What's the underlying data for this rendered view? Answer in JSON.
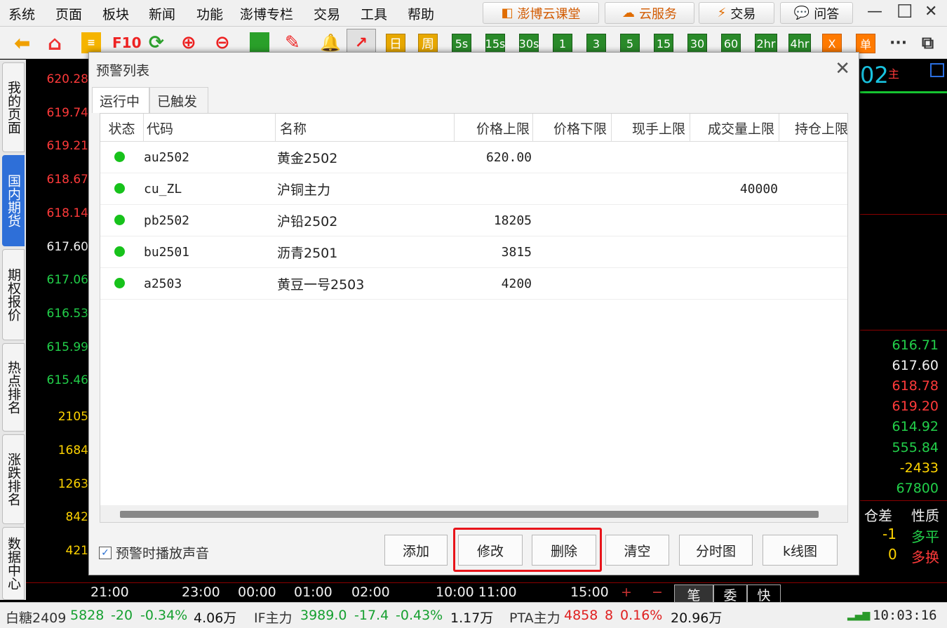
{
  "menu": [
    "系统",
    "页面",
    "板块",
    "新闻",
    "功能",
    "澎博专栏",
    "交易",
    "工具",
    "帮助"
  ],
  "header_buttons": {
    "cloud_class": "澎博云课堂",
    "cloud_service": "云服务",
    "trade": "交易",
    "qa": "问答"
  },
  "toolbar": {
    "f10": "F10",
    "periods": [
      "日",
      "周",
      "5s",
      "15s",
      "30s",
      "1",
      "3",
      "5",
      "15",
      "30",
      "60",
      "2hr",
      "4hr",
      "X",
      "单"
    ],
    "more": "···"
  },
  "sidenav": {
    "items": [
      "我的页面",
      "国内期货",
      "期权报价",
      "热点排名",
      "涨跌排名",
      "数据中心"
    ],
    "active": "国内期货",
    "expand_arrow": "▸"
  },
  "left_axis": {
    "prices": [
      {
        "v": "620.28",
        "c": "r"
      },
      {
        "v": "619.74",
        "c": "r"
      },
      {
        "v": "619.21",
        "c": "r"
      },
      {
        "v": "618.67",
        "c": "r"
      },
      {
        "v": "618.14",
        "c": "r"
      },
      {
        "v": "617.60",
        "c": "w"
      },
      {
        "v": "617.06",
        "c": "g"
      },
      {
        "v": "616.53",
        "c": "g"
      },
      {
        "v": "615.99",
        "c": "g"
      },
      {
        "v": "615.46",
        "c": "g"
      }
    ],
    "volumes": [
      "2105",
      "1684",
      "1263",
      "842",
      "421"
    ]
  },
  "right_panel": {
    "code_fragment": "02",
    "code_suffix": "主",
    "values": [
      {
        "v": "616.71",
        "c": "g"
      },
      {
        "v": "617.60",
        "c": "w"
      },
      {
        "v": "618.78",
        "c": "r"
      },
      {
        "v": "619.20",
        "c": "r"
      },
      {
        "v": "614.92",
        "c": "g"
      },
      {
        "v": "555.84",
        "c": "g"
      },
      {
        "v": "-2433",
        "c": "yl"
      },
      {
        "v": "67800",
        "c": "g"
      }
    ],
    "col_headers": [
      "仓差",
      "性质"
    ],
    "rows": [
      {
        "diff": "-1",
        "nature": "多平"
      },
      {
        "diff": "0",
        "nature": "多换"
      }
    ]
  },
  "time_axis": {
    "labels": [
      "21:00",
      "23:00",
      "00:00",
      "01:00",
      "02:00",
      "10:00 11:00",
      "15:00"
    ],
    "tabs": [
      "笔",
      "委",
      "快"
    ],
    "plus": "+",
    "minus": "−"
  },
  "status_bar": {
    "sugar": {
      "name": "白糖2409",
      "price": "5828",
      "chg": "-20",
      "pct": "-0.34%",
      "vol": "4.06万"
    },
    "if": {
      "name": "IF主力",
      "price": "3989.0",
      "chg": "-17.4",
      "pct": "-0.43%",
      "vol": "1.17万"
    },
    "pta": {
      "name": "PTA主力",
      "price": "4858",
      "chg": "8",
      "pct": "0.16%",
      "vol": "20.96万"
    },
    "clock": "10:03:16"
  },
  "dialog": {
    "title": "预警列表",
    "close": "✕",
    "tabs": [
      "运行中",
      "已触发"
    ],
    "columns": [
      "状态",
      "代码",
      "名称",
      "价格上限",
      "价格下限",
      "现手上限",
      "成交量上限",
      "持仓上限"
    ],
    "rows": [
      {
        "code": "au2502",
        "name": "黄金2502",
        "price_upper": "620.00",
        "vol_upper": ""
      },
      {
        "code": "cu_ZL",
        "name": "沪铜主力",
        "price_upper": "",
        "vol_upper": "40000"
      },
      {
        "code": "pb2502",
        "name": "沪铅2502",
        "price_upper": "18205",
        "vol_upper": ""
      },
      {
        "code": "bu2501",
        "name": "沥青2501",
        "price_upper": "3815",
        "vol_upper": ""
      },
      {
        "code": "a2503",
        "name": "黄豆一号2503",
        "price_upper": "4200",
        "vol_upper": ""
      }
    ],
    "sound_label": "预警时播放声音",
    "sound_checked": true,
    "buttons": {
      "add": "添加",
      "modify": "修改",
      "delete": "删除",
      "clear": "清空",
      "tick_chart": "分时图",
      "kline": "k线图"
    }
  },
  "colors": {
    "up": "#ff3a3a",
    "down": "#22d04a",
    "highlight": "#e8141a",
    "active_tab": "#2e6fd8"
  }
}
